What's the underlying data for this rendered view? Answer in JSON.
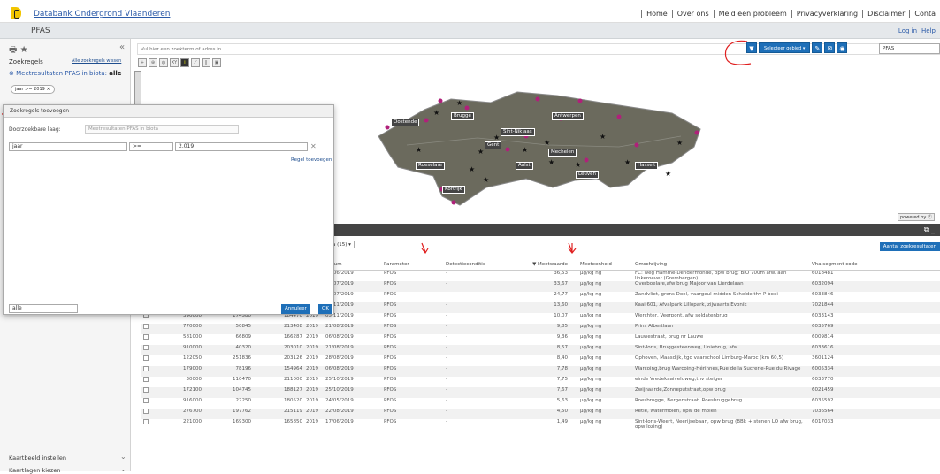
{
  "header": {
    "brand": "Databank Ondergrond Vlaanderen",
    "links": [
      "Home",
      "Over ons",
      "Meld een probleem",
      "Privacyverklaring",
      "Disclaimer",
      "Conta"
    ]
  },
  "titlebar": {
    "title": "PFAS",
    "login": "Log in",
    "help": "Help"
  },
  "sidebar": {
    "zoekregels_label": "Zoekregels",
    "wissen_label": "Alle zoekregels wissen",
    "layer_name": "Meetresultaten PFAS in biota:",
    "layer_scope": "alle",
    "chip": "jaar >= 2019 ×",
    "bottom1": "Kaartbeeld instellen",
    "bottom2": "Kaartlagen kiezen"
  },
  "search": {
    "placeholder": "Vul hier een zoekterm of adres in..."
  },
  "toolbar_right": {
    "area_button": "Selecteer gebied ▾",
    "layer_select": "PFAS"
  },
  "map": {
    "cities": [
      "Oostende",
      "Brugge",
      "Antwerpen",
      "Sint-Niklaas",
      "Gent",
      "Mechelen",
      "Roeselare",
      "Aalst",
      "Leuven",
      "Hasselt",
      "Kortrijk"
    ],
    "attribution": "powered by Ⓔ"
  },
  "table_toolbar": {
    "partial_select": "ca (15) ▾",
    "results_button": "Aantal zoekresultaten"
  },
  "table": {
    "columns": [
      "",
      "",
      "",
      "",
      "Datum",
      "Parameter",
      "Detectieconditie",
      "▼ Meetwaarde",
      "Meeteenheid",
      "Omschrijving",
      "Vha segment code"
    ],
    "rows": [
      [
        "",
        "",
        "",
        "019",
        "14/06/2019",
        "PFOS",
        "-",
        "36,53",
        "µg/kg ng",
        "FC: weg Hamme-Dendermonde, opw brug; BIO 700m afw. aan linkeroever (Grembergen)",
        "6018481"
      ],
      [
        "",
        "",
        "",
        "019",
        "24/07/2019",
        "PFOS",
        "-",
        "33,67",
        "µg/kg ng",
        "Overboelare,afw brug Majoor van Lierdelaan",
        "6032094"
      ],
      [
        "",
        "",
        "",
        "019",
        "17/07/2019",
        "PFOS",
        "-",
        "24,77",
        "µg/kg ng",
        "Zandvliet, grens Doel, vaargeul midden Schelde thv P boei",
        "6033846"
      ],
      [
        "",
        "804000",
        "146492",
        "221980",
        "2019",
        "04/11/2019",
        "PFOS",
        "-",
        "13,60",
        "µg/kg ng",
        "Kaai 601, Afvalpark Lillopark, zijwaarts Evonik",
        "7021844"
      ],
      [
        "",
        "390000",
        "174580",
        "184470",
        "2019",
        "05/11/2019",
        "PFOS",
        "-",
        "10,07",
        "µg/kg ng",
        "Werchter, Veerpont, afw soldatenbrug",
        "6033143"
      ],
      [
        "",
        "770000",
        "50845",
        "213408",
        "2019",
        "21/08/2019",
        "PFOS",
        "-",
        "9,85",
        "µg/kg ng",
        "Prins Albertlaan",
        "6035769"
      ],
      [
        "",
        "581000",
        "66809",
        "166287",
        "2019",
        "06/08/2019",
        "PFOS",
        "-",
        "9,36",
        "µg/kg ng",
        "Lauwestraat, brug nr Lauwe",
        "6009814"
      ],
      [
        "",
        "910000",
        "40320",
        "203010",
        "2019",
        "21/08/2019",
        "PFOS",
        "-",
        "8,57",
        "µg/kg ng",
        "Sint-Ioris, Bruggesteenweg, Uniebrug, afw",
        "6033616"
      ],
      [
        "",
        "122050",
        "251836",
        "203126",
        "2019",
        "28/08/2019",
        "PFOS",
        "-",
        "8,40",
        "µg/kg ng",
        "Ophoven, Maasdijk, tgo vaarschool Limburg-Maroc (km 60,5)",
        "3601124"
      ],
      [
        "",
        "179000",
        "78196",
        "154964",
        "2019",
        "06/08/2019",
        "PFOS",
        "-",
        "7,78",
        "µg/kg ng",
        "Warcoing,brug Warcoing-Hérinnes,Rue de la Sucrerie-Rue du Rivage",
        "6005334"
      ],
      [
        "",
        "30000",
        "110470",
        "211000",
        "2019",
        "25/10/2019",
        "PFOS",
        "-",
        "7,75",
        "µg/kg ng",
        "einde Vredekaaiveldweg,thv steiger",
        "6033770"
      ],
      [
        "",
        "172100",
        "104745",
        "188127",
        "2019",
        "25/10/2019",
        "PFOS",
        "-",
        "7,67",
        "µg/kg ng",
        "Zwijnaarde,Zonneputstraat,opw brug",
        "6021459"
      ],
      [
        "",
        "916000",
        "27250",
        "180520",
        "2019",
        "24/05/2019",
        "PFOS",
        "-",
        "5,63",
        "µg/kg ng",
        "Roesbrugge, Bergenstraat, Roesbruggebrug",
        "6035592"
      ],
      [
        "",
        "276700",
        "197762",
        "215119",
        "2019",
        "22/08/2019",
        "PFOS",
        "-",
        "4,50",
        "µg/kg ng",
        "Retie, watermolen, opw de molen",
        "7036564"
      ],
      [
        "",
        "221000",
        "169300",
        "165850",
        "2019",
        "17/06/2019",
        "PFOS",
        "-",
        "1,49",
        "µg/kg ng",
        "Sint-Ioris-Weert, Neerijsebaan, opw brug (BBI: + stenen LO afw brug, opw lozing)",
        "6017033"
      ]
    ]
  },
  "dialog": {
    "title": "Zoekregels toevoegen",
    "layer_label": "Doorzoekbare laag:",
    "layer_value": "Meetresultaten PFAS in biota",
    "field": "jaar",
    "operator": ">=",
    "value": "2.019",
    "add_rule": "Regel toevoegen",
    "combine": "alle",
    "cancel": "Annuleer",
    "ok": "OK"
  }
}
